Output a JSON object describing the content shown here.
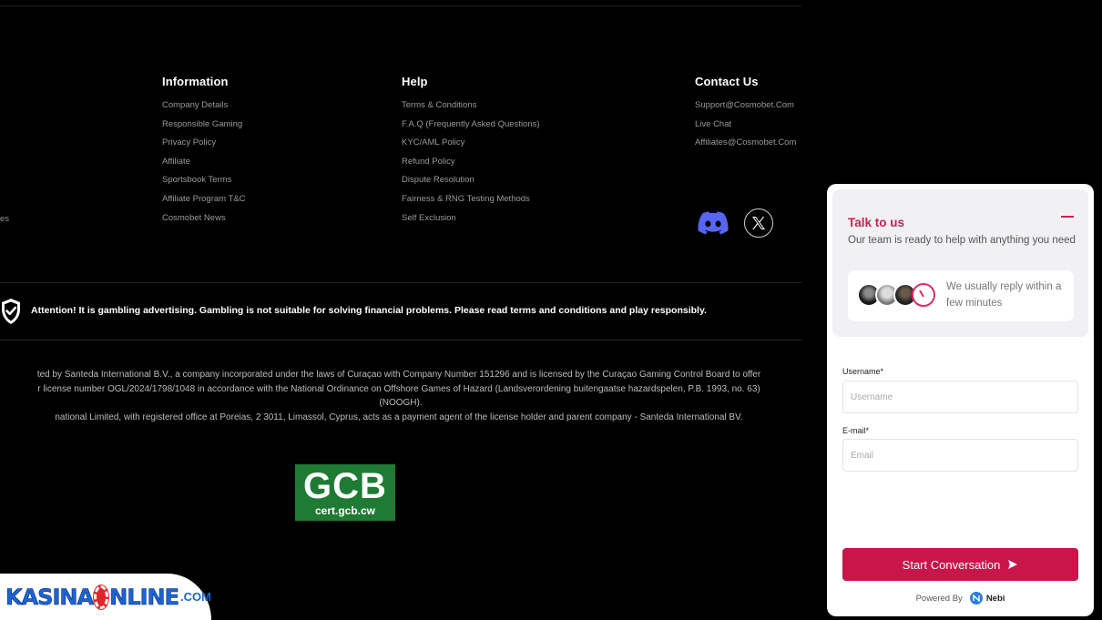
{
  "footer": {
    "information": {
      "title": "Information",
      "links": [
        "Company Details",
        "Responsible Gaming",
        "Privacy Policy",
        "Affiliate",
        "Sportsbook Terms",
        "Affiliate Program T&C",
        "Cosmobet News"
      ]
    },
    "help": {
      "title": "Help",
      "links": [
        "Terms & Conditions",
        "F.A.Q (Frequently Asked Questions)",
        "KYC/AML Policy",
        "Refund Policy",
        "Dispute Resolution",
        "Fairness & RNG Testing Methods",
        "Self Exclusion"
      ]
    },
    "contact": {
      "title": "Contact Us",
      "links": [
        "Support@Cosmobet.Com",
        "Live Chat",
        "Affiliates@Cosmobet.Com"
      ]
    },
    "stray_fragment": "es",
    "social": {
      "icons": [
        "discord-icon",
        "x-icon"
      ],
      "discord_color": "#5865F2"
    },
    "attention": "Attention! It is gambling advertising. Gambling is not suitable for solving financial problems. Please read terms and conditions and play responsibly.",
    "legal": [
      "ted by Santeda International B.V., a company incorporated under the laws of Curaçao with Company Number 151296 and is licensed by the Curaçao Gaming Control Board to offer",
      "r license number OGL/2024/1798/1048 in accordance with the National Ordinance on Offshore Games of Hazard (Landsverordening buitengaatse hazardspelen, P.B. 1993, no. 63)",
      "(NOOGH).",
      "national Limited, with registered office at Poreias, 2 3011, Limassol, Cyprus, acts as a payment agent of the license holder and parent company - Santeda International BV."
    ],
    "gcb": {
      "title": "GCB",
      "subtitle": "cert.gcb.cw",
      "color": "#1f7a33"
    }
  },
  "watermark": {
    "part1": "KASINA",
    "part2": "NLINE",
    "suffix": ".COM"
  },
  "chat": {
    "title": "Talk to us",
    "subtitle": "Our team is ready to help with anything you need",
    "reply_text": "We usually reply within a few minutes",
    "username_label": "Username*",
    "username_placeholder": "Username",
    "email_label": "E-mail*",
    "email_placeholder": "Email",
    "start_button": "Start Conversation",
    "powered_by": "Powered By",
    "brand": "Nebi",
    "accent": "#c8164a"
  }
}
